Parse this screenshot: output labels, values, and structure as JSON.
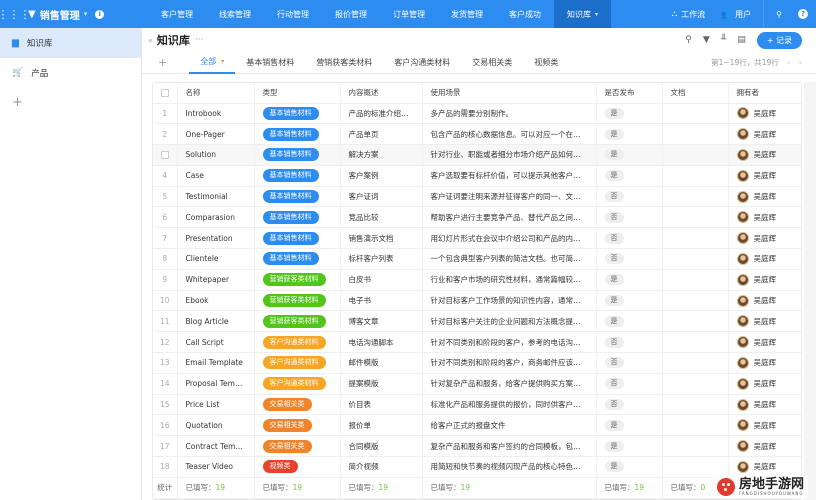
{
  "app": {
    "title": "销售管理",
    "nav": [
      {
        "label": "客户管理",
        "active": false
      },
      {
        "label": "线索管理",
        "active": false
      },
      {
        "label": "行动管理",
        "active": false
      },
      {
        "label": "报价管理",
        "active": false
      },
      {
        "label": "订单管理",
        "active": false
      },
      {
        "label": "发货管理",
        "active": false
      },
      {
        "label": "客户成功",
        "active": false
      },
      {
        "label": "知识库",
        "active": true
      }
    ],
    "workflow_label": "工作流",
    "users_label": "用户"
  },
  "sidebar": {
    "items": [
      {
        "label": "知识库",
        "icon": "book-icon",
        "active": true
      },
      {
        "label": "产品",
        "icon": "cart-icon",
        "active": false
      }
    ]
  },
  "page": {
    "title": "知识库",
    "add_record_label": "+ 记录",
    "tabs": [
      {
        "label": "全部",
        "active": true
      },
      {
        "label": "基本销售材料",
        "active": false
      },
      {
        "label": "营销获客类材料",
        "active": false
      },
      {
        "label": "客户沟通类材料",
        "active": false
      },
      {
        "label": "交易相关类",
        "active": false
      },
      {
        "label": "视频类",
        "active": false
      }
    ],
    "pager_text": "第1~19行，共19行"
  },
  "colors": {
    "基本销售材料": "#2d8cf0",
    "营销获客类材料": "#52c41a",
    "客户沟通类材料": "#f5a623",
    "交易相关类": "#f0842c",
    "视频类": "#e8412c"
  },
  "table": {
    "columns": [
      "名称",
      "类型",
      "内容概述",
      "使用场景",
      "是否发布",
      "文档",
      "拥有者"
    ],
    "rows": [
      {
        "n": "1",
        "name": "Introbook",
        "type": "基本销售材料",
        "summary": "产品的标准介绍手册",
        "scene": "多产品的需要分别制作。",
        "pub": "是",
        "owner": "吴庭辉"
      },
      {
        "n": "2",
        "name": "One-Pager",
        "type": "基本销售材料",
        "summary": "产品单页",
        "scene": "包含产品的核心数据信息。可以对应一个在线...",
        "pub": "是",
        "owner": "吴庭辉"
      },
      {
        "n": "",
        "name": "Solution",
        "type": "基本销售材料",
        "summary": "解决方案",
        "scene": "针对行业、职能或者细分市场介绍产品如何解...",
        "pub": "是",
        "owner": "吴庭辉"
      },
      {
        "n": "4",
        "name": "Case",
        "type": "基本销售材料",
        "summary": "客户案例",
        "scene": "客户选取要有标杆价值，可以提示其他客户使...",
        "pub": "是",
        "owner": "吴庭辉"
      },
      {
        "n": "5",
        "name": "Testimonial",
        "type": "基本销售材料",
        "summary": "客户证词",
        "scene": "客户证词要注明来源并征得客户的同一、文案...",
        "pub": "否",
        "owner": "吴庭辉"
      },
      {
        "n": "6",
        "name": "Comparasion",
        "type": "基本销售材料",
        "summary": "竞品比较",
        "scene": "帮助客户进行主要竞争产品、替代产品之间的...",
        "pub": "否",
        "owner": "吴庭辉"
      },
      {
        "n": "7",
        "name": "Presentation",
        "type": "基本销售材料",
        "summary": "销售演示文档",
        "scene": "用幻灯片形式在会议中介绍公司和产品的内容...",
        "pub": "否",
        "owner": "吴庭辉"
      },
      {
        "n": "8",
        "name": "Clientele",
        "type": "基本销售材料",
        "summary": "标杆客户列表",
        "scene": "一个包含典型客户列表的简洁文档。也可简略...",
        "pub": "否",
        "owner": "吴庭辉"
      },
      {
        "n": "9",
        "name": "Whitepaper",
        "type": "营销获客类材料",
        "summary": "白皮书",
        "scene": "行业和客户市场的研究性材料，通常篇幅较长...",
        "pub": "是",
        "owner": "吴庭辉"
      },
      {
        "n": "10",
        "name": "Ebook",
        "type": "营销获客类材料",
        "summary": "电子书",
        "scene": "针对目标客户工作场景的知识性内容，通常是...",
        "pub": "是",
        "owner": "吴庭辉"
      },
      {
        "n": "11",
        "name": "Blog Article",
        "type": "营销获客类材料",
        "summary": "博客文章",
        "scene": "针对目标客户关注的企业问题和方法概念提供...",
        "pub": "是",
        "owner": "吴庭辉"
      },
      {
        "n": "12",
        "name": "Call Script",
        "type": "客户沟通类材料",
        "summary": "电话沟通脚本",
        "scene": "针对不同类别和阶段的客户，参考的电话沟通...",
        "pub": "否",
        "owner": "吴庭辉"
      },
      {
        "n": "13",
        "name": "Email Template",
        "type": "客户沟通类材料",
        "summary": "邮件模版",
        "scene": "针对不同类别和阶段的客户，商务邮件应该如...",
        "pub": "否",
        "owner": "吴庭辉"
      },
      {
        "n": "14",
        "name": "Proposal Template",
        "type": "客户沟通类材料",
        "summary": "提案模版",
        "scene": "针对复杂产品和服务，给客户提供购买方案时...",
        "pub": "否",
        "owner": "吴庭辉"
      },
      {
        "n": "15",
        "name": "Price List",
        "type": "交易相关类",
        "summary": "价目表",
        "scene": "标准化产品和服务提供的报价，同时供客户选...",
        "pub": "否",
        "owner": "吴庭辉"
      },
      {
        "n": "16",
        "name": "Quotation",
        "type": "交易相关类",
        "summary": "报价单",
        "scene": "给客户正式的报盘文件",
        "pub": "是",
        "owner": "吴庭辉"
      },
      {
        "n": "17",
        "name": "Contract Template",
        "type": "交易相关类",
        "summary": "合同模版",
        "scene": "复杂产品和服务和客户签约的合同模板，包含...",
        "pub": "是",
        "owner": "吴庭辉"
      },
      {
        "n": "18",
        "name": "Teaser Video",
        "type": "视频类",
        "summary": "简介视频",
        "scene": "用简短和快节奏的视频闪现产品的核心特色。...",
        "pub": "是",
        "owner": "吴庭辉"
      }
    ],
    "footer": {
      "row_label": "统计",
      "filled_label": "已填写：",
      "counts": [
        "19",
        "19",
        "19",
        "19",
        "19",
        "0",
        ""
      ]
    }
  },
  "watermark": {
    "text": "房地手游网",
    "sub": "FANGDISHOUYOUWANG"
  }
}
